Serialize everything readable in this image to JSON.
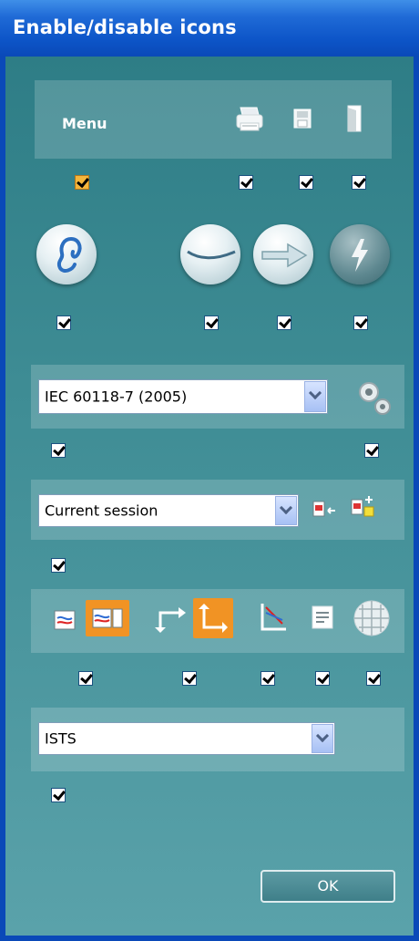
{
  "window": {
    "title": "Enable/disable icons"
  },
  "menu_bar": {
    "label": "Menu",
    "icons": [
      "printer-icon",
      "save-icon",
      "exit-door-icon"
    ]
  },
  "mode_icons": [
    "ear-icon",
    "handpiece-icon",
    "forward-arrow-icon",
    "lightning-icon"
  ],
  "standard": {
    "selected": "IEC 60118-7  (2005)",
    "icon": "settings-gears-icon"
  },
  "session": {
    "selected": "Current session",
    "icons": [
      "session-arrow-icon",
      "session-add-icon"
    ]
  },
  "view_icons": [
    "single-graph-icon",
    "dual-graph-icon",
    "axes-icon",
    "axes-highlight-icon",
    "curve-axes-icon",
    "notes-icon",
    "grid-sphere-icon"
  ],
  "signal": {
    "selected": "ISTS"
  },
  "buttons": {
    "ok": "OK"
  },
  "colors": {
    "title_bar": "#0a49b8",
    "panel_bg": "#3f8d95",
    "highlight": "#f19324"
  }
}
